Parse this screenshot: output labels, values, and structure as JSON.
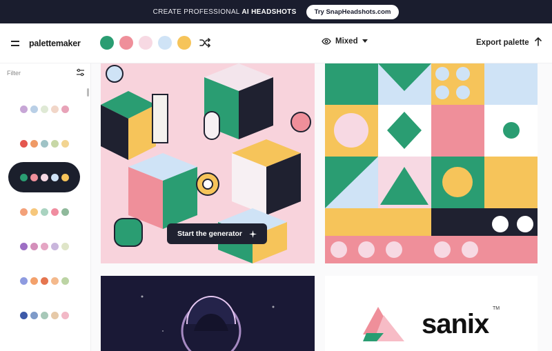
{
  "banner": {
    "text_prefix": "CREATE PROFESSIONAL",
    "text_bold": "AI HEADSHOTS",
    "cta_label": "Try SnapHeadshots.com"
  },
  "header": {
    "logo": "palettemaker",
    "swatches": [
      "#2a9d72",
      "#ef8f9a",
      "#f7d9e3",
      "#cfe3f6",
      "#f6c45a"
    ],
    "mode_label": "Mixed",
    "export_label": "Export palette"
  },
  "sidebar": {
    "filter_placeholder": "Filter",
    "palettes": [
      [
        "#c7a6d6",
        "#b9cfe6",
        "#dfe9d5",
        "#f1d6c8",
        "#e8a3b8"
      ],
      [
        "#e4574f",
        "#ef9a66",
        "#9fc3c6",
        "#c7d7a6",
        "#f2d491"
      ],
      [
        "#2a9d72",
        "#ef8f9a",
        "#f7d9e3",
        "#cfe3f6",
        "#f6c45a"
      ],
      [
        "#f3a17a",
        "#f6c77c",
        "#a9d3c0",
        "#f08da0",
        "#8fb99b"
      ],
      [
        "#9d6fc4",
        "#d48fba",
        "#e5a6c4",
        "#c9b6dc",
        "#dfe5c8"
      ],
      [
        "#8e9be0",
        "#f3a16c",
        "#e5754f",
        "#f4b98c",
        "#bcd4a4"
      ],
      [
        "#3d5aa8",
        "#7f9bc9",
        "#a7c8b8",
        "#e6c9a8",
        "#f2b8c6"
      ]
    ]
  },
  "main": {
    "cta_label": "Start the generator",
    "brand_card_text": "sanix",
    "brand_card_tm": "TM"
  }
}
